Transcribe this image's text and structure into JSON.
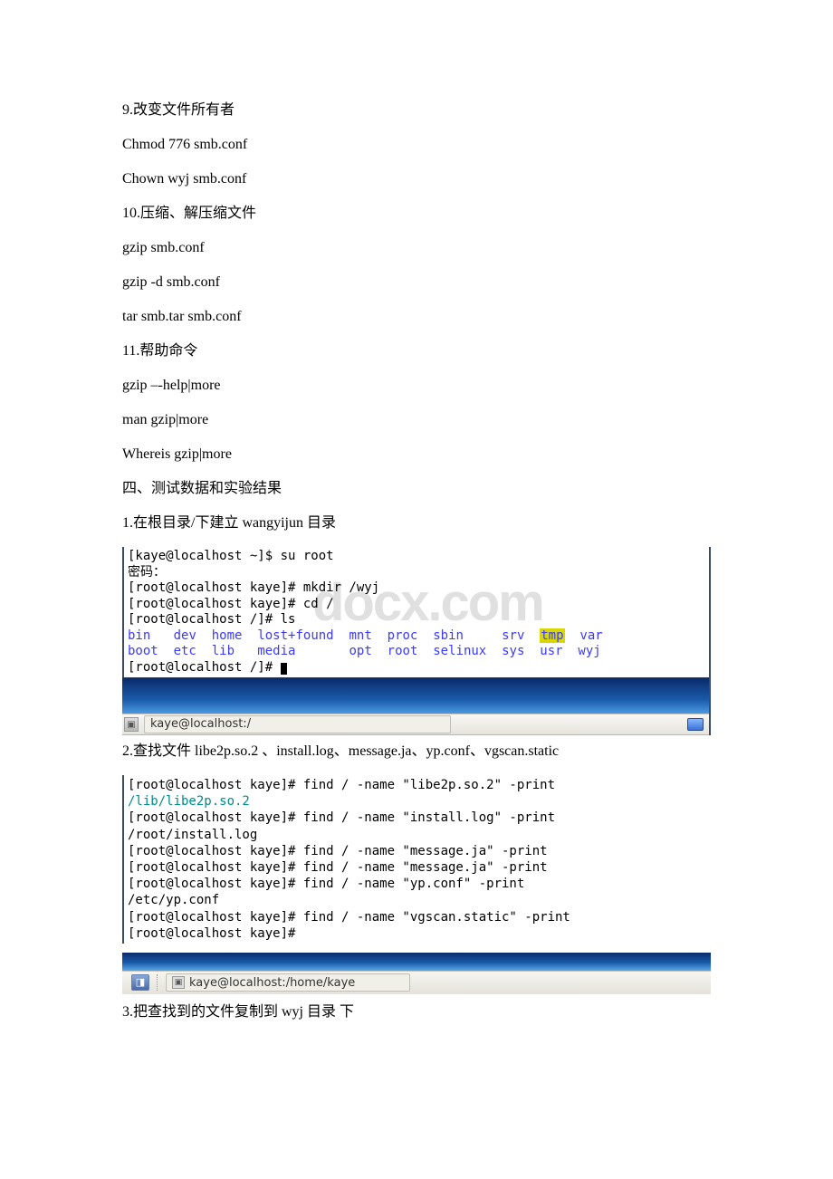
{
  "text": {
    "l1": "9.改变文件所有者",
    "l2": "Chmod 776 smb.conf",
    "l3": "Chown wyj smb.conf",
    "l4": "10.压缩、解压缩文件",
    "l5": "gzip smb.conf",
    "l6": "gzip -d smb.conf",
    "l7": "tar smb.tar smb.conf",
    "l8": "11.帮助命令",
    "l9": "gzip –-help|more",
    "l10": "man gzip|more",
    "l11": "Whereis gzip|more",
    "l12": "四、测试数据和实验结果",
    "l13": "1.在根目录/下建立 wangyijun 目录",
    "l14": "2.查找文件 libe2p.so.2 、install.log、message.ja、yp.conf、vgscan.static",
    "l15": "3.把查找到的文件复制到 wyj 目录 下"
  },
  "watermark": "docx.com",
  "term1": {
    "t1": "[kaye@localhost ~]$ su root",
    "t2": "密码：",
    "t3": "[root@localhost kaye]# mkdir /wyj",
    "t4": "[root@localhost kaye]# cd /",
    "t5": "[root@localhost /]# ls",
    "ls_row1": {
      "bin": "bin",
      "dev": "dev",
      "home": "home",
      "lost": "lost+found",
      "mnt": "mnt",
      "proc": "proc",
      "sbin": "sbin",
      "srv": "srv",
      "tmp": "tmp",
      "var": "var"
    },
    "ls_row2": {
      "boot": "boot",
      "etc": "etc",
      "lib": "lib",
      "media": "media",
      "opt": "opt",
      "root": "root",
      "selinux": "selinux",
      "sys": "sys",
      "usr": "usr",
      "wyj": "wyj"
    },
    "t8": "[root@localhost /]# "
  },
  "taskbar1": {
    "title": "kaye@localhost:/"
  },
  "term2": {
    "r1": "[root@localhost kaye]# find / -name \"libe2p.so.2\" -print",
    "r2": "/lib/libe2p.so.2",
    "r3": "[root@localhost kaye]# find / -name \"install.log\" -print",
    "r4": "/root/install.log",
    "r5": "[root@localhost kaye]# find / -name \"message.ja\" -print",
    "r6": "[root@localhost kaye]# find / -name \"message.ja\" -print",
    "r7": "[root@localhost kaye]# find / -name \"yp.conf\" -print",
    "r8": "/etc/yp.conf",
    "r9": "[root@localhost kaye]# find / -name \"vgscan.static\" -print",
    "r10": "[root@localhost kaye]#"
  },
  "taskbar2": {
    "title": "kaye@localhost:/home/kaye"
  }
}
